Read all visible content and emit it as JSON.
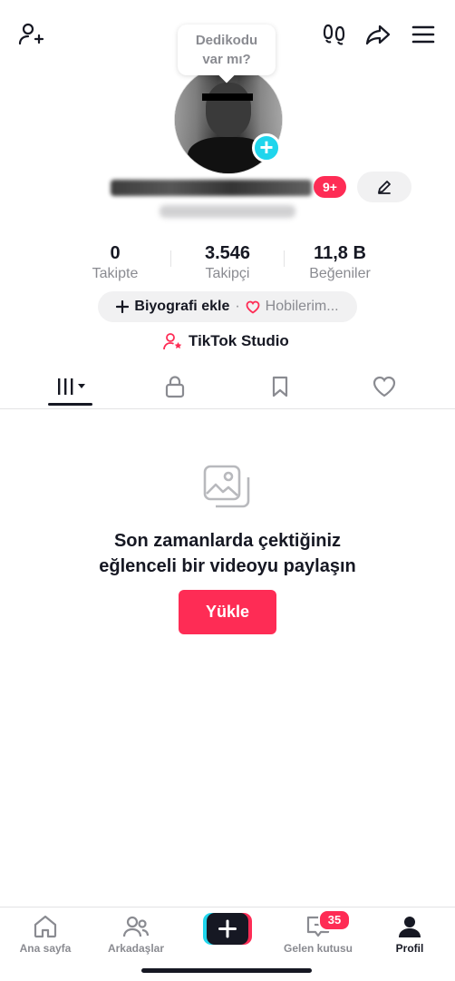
{
  "header": {
    "add_friend_icon": "person-plus-icon",
    "footprints_icon": "footprints-icon",
    "share_icon": "share-arrow-icon",
    "menu_icon": "hamburger-menu-icon"
  },
  "profile": {
    "note_bubble": "Dedikodu\nvar mı?",
    "notification_badge": "9+"
  },
  "stats": [
    {
      "value": "0",
      "label": "Takipte"
    },
    {
      "value": "3.546",
      "label": "Takipçi"
    },
    {
      "value": "11,8 B",
      "label": "Beğeniler"
    }
  ],
  "bio": {
    "add_label": "Biyografi ekle",
    "separator": "·",
    "hobbies_label": "Hobilerim..."
  },
  "studio": {
    "label": "TikTok Studio"
  },
  "tabs": [
    {
      "name": "videos",
      "icon": "grid-bars-icon",
      "active": true
    },
    {
      "name": "private",
      "icon": "lock-icon"
    },
    {
      "name": "saved",
      "icon": "bookmark-icon"
    },
    {
      "name": "liked",
      "icon": "heart-icon"
    }
  ],
  "empty_state": {
    "message": "Son zamanlarda çektiğiniz\neğlenceli bir videoyu paylaşın",
    "upload_label": "Yükle"
  },
  "bottom_nav": {
    "home": "Ana sayfa",
    "friends": "Arkadaşlar",
    "inbox": "Gelen kutusu",
    "inbox_badge": "35",
    "profile": "Profil"
  },
  "colors": {
    "accent": "#fe2c55",
    "cyan": "#20d5ec",
    "text": "#161823",
    "muted": "#8a8b91"
  }
}
